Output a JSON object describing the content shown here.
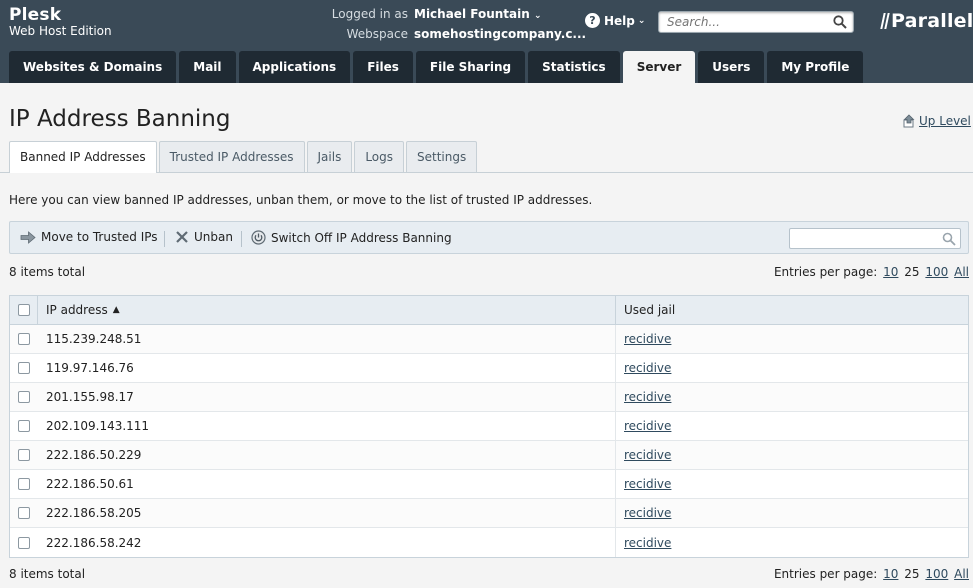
{
  "header": {
    "brand_name": "Plesk",
    "brand_edition": "Web Host Edition",
    "logged_in_label": "Logged in as",
    "logged_in_user": "Michael Fountain",
    "webspace_label": "Webspace",
    "webspace_value": "somehostingcompany.c...",
    "help_label": "Help",
    "search_placeholder": "Search...",
    "logo_text": "Parallels"
  },
  "main_tabs": [
    {
      "label": "Websites & Domains",
      "active": false
    },
    {
      "label": "Mail",
      "active": false
    },
    {
      "label": "Applications",
      "active": false
    },
    {
      "label": "Files",
      "active": false
    },
    {
      "label": "File Sharing",
      "active": false
    },
    {
      "label": "Statistics",
      "active": false
    },
    {
      "label": "Server",
      "active": true
    },
    {
      "label": "Users",
      "active": false
    },
    {
      "label": "My Profile",
      "active": false
    }
  ],
  "page": {
    "title": "IP Address Banning",
    "up_level": "Up Level",
    "description": "Here you can view banned IP addresses, unban them, or move to the list of trusted IP addresses."
  },
  "sub_tabs": [
    {
      "label": "Banned IP Addresses",
      "active": true
    },
    {
      "label": "Trusted IP Addresses",
      "active": false
    },
    {
      "label": "Jails",
      "active": false
    },
    {
      "label": "Logs",
      "active": false
    },
    {
      "label": "Settings",
      "active": false
    }
  ],
  "toolbar": {
    "move_label": "Move to Trusted IPs",
    "unban_label": "Unban",
    "switch_off_label": "Switch Off IP Address Banning",
    "search_value": ""
  },
  "list": {
    "items_total": "8 items total",
    "entries_per_page_label": "Entries per page:",
    "page_sizes": [
      "10",
      "25",
      "100",
      "All"
    ],
    "current_page_size": "25"
  },
  "table": {
    "columns": {
      "ip": "IP address",
      "jail": "Used jail"
    },
    "rows": [
      {
        "ip": "115.239.248.51",
        "jail": "recidive"
      },
      {
        "ip": "119.97.146.76",
        "jail": "recidive"
      },
      {
        "ip": "201.155.98.17",
        "jail": "recidive"
      },
      {
        "ip": "202.109.143.111",
        "jail": "recidive"
      },
      {
        "ip": "222.186.50.229",
        "jail": "recidive"
      },
      {
        "ip": "222.186.50.61",
        "jail": "recidive"
      },
      {
        "ip": "222.186.58.205",
        "jail": "recidive"
      },
      {
        "ip": "222.186.58.242",
        "jail": "recidive"
      }
    ]
  },
  "colors": {
    "header_bg": "#3a4a57",
    "tab_bg": "#1f2a33",
    "link": "#2f4a5e",
    "toolbar_bg": "#e7edf2"
  }
}
